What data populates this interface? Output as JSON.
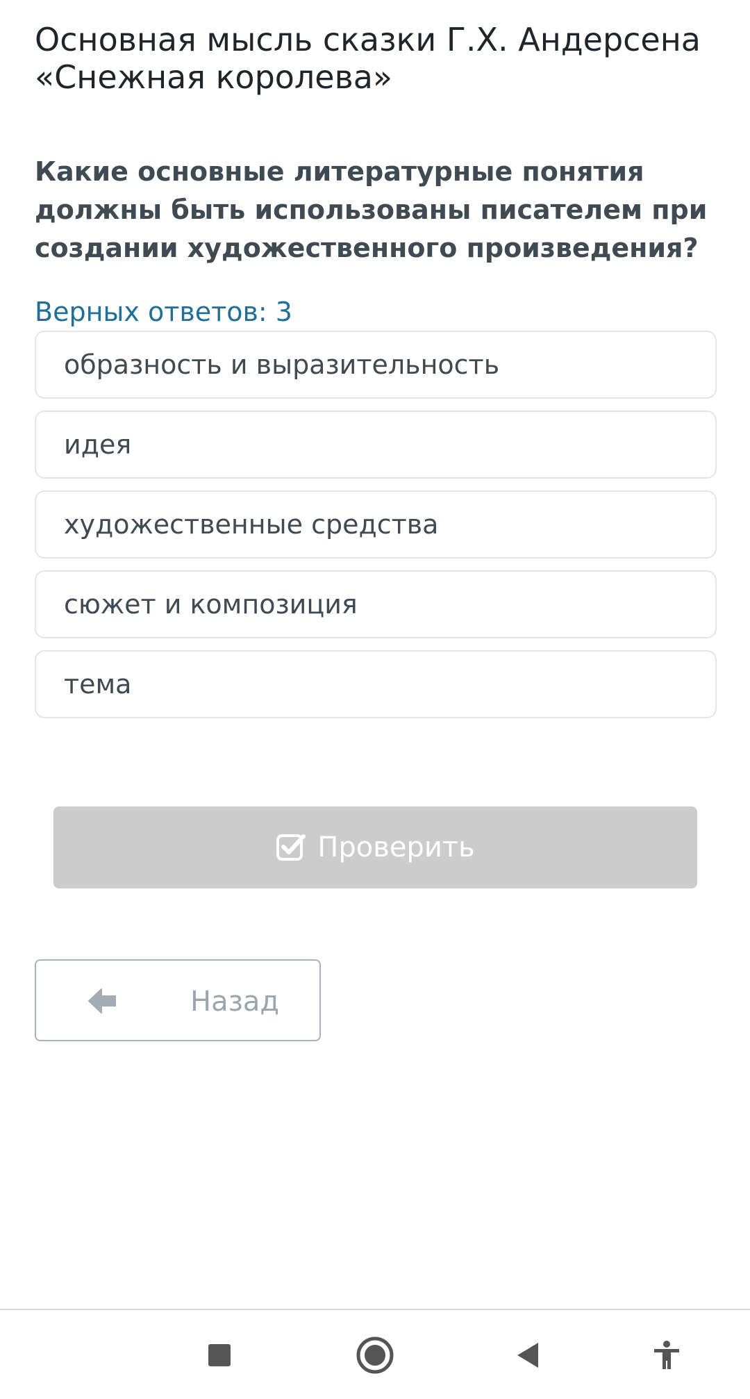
{
  "lesson": {
    "title": "Основная мысль сказки Г.Х. Андерсена «Снежная королева»"
  },
  "question": {
    "text": "Какие основные литературные понятия должны быть использованы писателем при создании художественного произведения?",
    "answers_count": "Верных ответов: 3"
  },
  "options": [
    {
      "label": "образность и выразительность"
    },
    {
      "label": "идея"
    },
    {
      "label": "художественные средства"
    },
    {
      "label": "сюжет и композиция"
    },
    {
      "label": "тема"
    }
  ],
  "actions": {
    "check_label": "Проверить",
    "check_icon": "checkbox-check-icon",
    "back_label": "Назад",
    "back_icon": "arrow-left-icon"
  },
  "navbar": {
    "buttons": [
      "recents-icon",
      "home-icon",
      "back-triangle-icon",
      "accessibility-icon"
    ]
  },
  "colors": {
    "accent_link": "#1f6f9a",
    "disabled_button": "#cccccc",
    "text_dark": "#3f4a52",
    "border": "#e3e5e7"
  }
}
